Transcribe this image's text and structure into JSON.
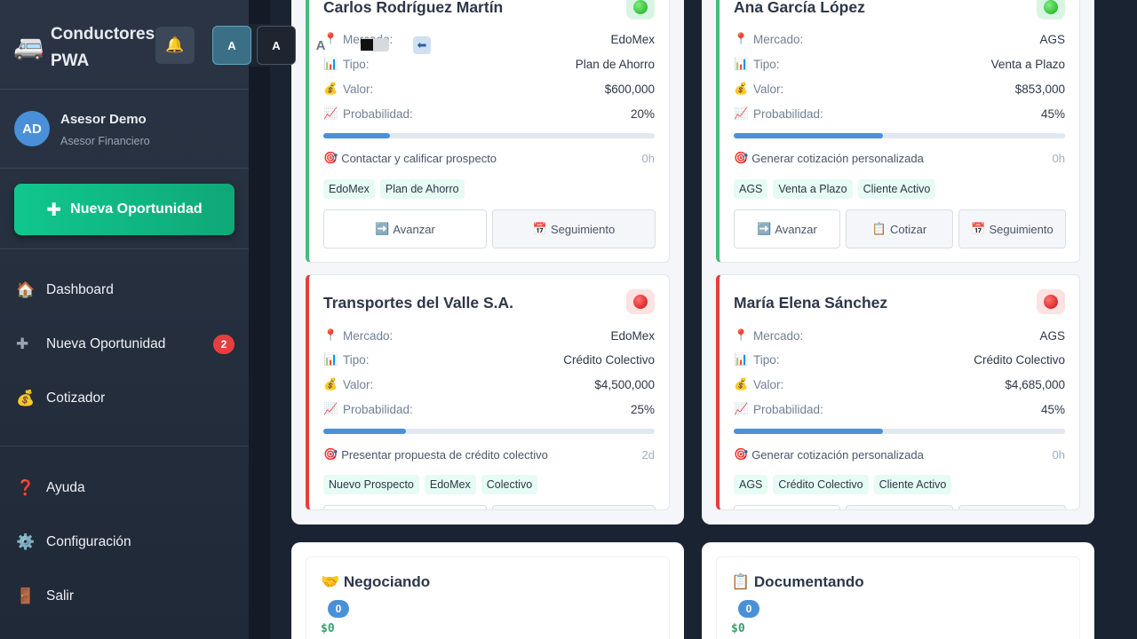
{
  "brand": {
    "title": "Conductores PWA",
    "icon": "bus-icon"
  },
  "user": {
    "initials": "AD",
    "name": "Asesor Demo",
    "role": "Asesor Financiero"
  },
  "new_opportunity_button": {
    "label": "Nueva Oportunidad"
  },
  "accessibility": {
    "btn1": "A",
    "btn2": "A",
    "btn3": "A"
  },
  "nav": {
    "items": [
      {
        "label": "Dashboard",
        "icon": "house-icon"
      },
      {
        "label": "Nueva Oportunidad",
        "icon": "plus-icon",
        "badge": "2"
      },
      {
        "label": "Cotizador",
        "icon": "money-bag-icon"
      }
    ],
    "bottom": [
      {
        "label": "Ayuda",
        "icon": "question-icon"
      },
      {
        "label": "Configuración",
        "icon": "gear-icon"
      },
      {
        "label": "Salir",
        "icon": "door-icon"
      }
    ]
  },
  "labels": {
    "mercado": "Mercado:",
    "tipo": "Tipo:",
    "valor": "Valor:",
    "probabilidad": "Probabilidad:"
  },
  "cards": [
    {
      "name": "Carlos Rodríguez Martín",
      "status": "green",
      "mercado": "EdoMex",
      "tipo": "Plan de Ahorro",
      "valor": "$600,000",
      "probabilidad": "20%",
      "prob_fraction": 0.2,
      "task": "Contactar y calificar prospecto",
      "time": "0h",
      "tags": [
        "EdoMex",
        "Plan de Ahorro"
      ],
      "buttons": [
        "Avanzar",
        "Seguimiento"
      ]
    },
    {
      "name": "Ana García López",
      "status": "green",
      "mercado": "AGS",
      "tipo": "Venta a Plazo",
      "valor": "$853,000",
      "probabilidad": "45%",
      "prob_fraction": 0.45,
      "task": "Generar cotización personalizada",
      "time": "0h",
      "tags": [
        "AGS",
        "Venta a Plazo",
        "Cliente Activo"
      ],
      "buttons": [
        "Avanzar",
        "Cotizar",
        "Seguimiento"
      ]
    },
    {
      "name": "Transportes del Valle S.A.",
      "status": "red",
      "mercado": "EdoMex",
      "tipo": "Crédito Colectivo",
      "valor": "$4,500,000",
      "probabilidad": "25%",
      "prob_fraction": 0.25,
      "task": "Presentar propuesta de crédito colectivo",
      "time": "2d",
      "tags": [
        "Nuevo Prospecto",
        "EdoMex",
        "Colectivo"
      ]
    },
    {
      "name": "María Elena Sánchez",
      "status": "red",
      "mercado": "AGS",
      "tipo": "Crédito Colectivo",
      "valor": "$4,685,000",
      "probabilidad": "45%",
      "prob_fraction": 0.45,
      "task": "Generar cotización personalizada",
      "time": "0h",
      "tags": [
        "AGS",
        "Crédito Colectivo",
        "Cliente Activo"
      ]
    }
  ],
  "stages": [
    {
      "title": "Negociando",
      "icon": "handshake-icon",
      "count": "0",
      "total": "$0"
    },
    {
      "title": "Documentando",
      "icon": "clipboard-icon",
      "count": "0",
      "total": "$0"
    }
  ]
}
